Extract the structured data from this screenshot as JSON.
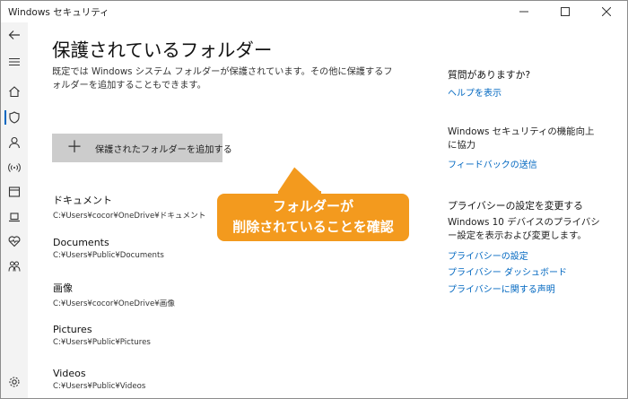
{
  "window": {
    "title": "Windows セキュリティ",
    "controls": {
      "minimize": "—",
      "maximize": "☐",
      "close": "✕"
    }
  },
  "rail": {
    "items": [
      "back-icon",
      "menu-icon",
      "home-icon",
      "shield-icon",
      "person-icon",
      "wireless-icon",
      "app-browser-icon",
      "device-laptop-icon",
      "heart-icon",
      "family-icon",
      "settings-icon"
    ],
    "selected": "shield-icon",
    "accent": "#0067c0"
  },
  "main": {
    "title": "保護されているフォルダー",
    "description": "既定では Windows システム フォルダーが保護されています。その他に保護するフォルダーを追加することもできます。",
    "add_button": {
      "icon": "＋",
      "label": "保護されたフォルダーを追加する"
    },
    "folders": [
      {
        "name": "ドキュメント",
        "path": "C:¥Users¥cocor¥OneDrive¥ドキュメント"
      },
      {
        "name": "Documents",
        "path": "C:¥Users¥Public¥Documents"
      },
      {
        "name": "画像",
        "path": "C:¥Users¥cocor¥OneDrive¥画像"
      },
      {
        "name": "Pictures",
        "path": "C:¥Users¥Public¥Pictures"
      },
      {
        "name": "Videos",
        "path": "C:¥Users¥Public¥Videos"
      }
    ]
  },
  "sidebar": {
    "help": {
      "heading": "質問がありますか?",
      "link": "ヘルプを表示"
    },
    "improve": {
      "heading": "Windows セキュリティの機能向上に協力",
      "link": "フィードバックの送信"
    },
    "privacy": {
      "heading": "プライバシーの設定を変更する",
      "text": "Windows 10 デバイスのプライバシー設定を表示および変更します。",
      "links": [
        "プライバシーの設定",
        "プライバシー ダッシュボード",
        "プライバシーに関する声明"
      ]
    },
    "link_color": "#0067c0"
  },
  "callout": {
    "line1": "フォルダーが",
    "line2": "削除されていることを確認",
    "color": "#f39a1e"
  }
}
